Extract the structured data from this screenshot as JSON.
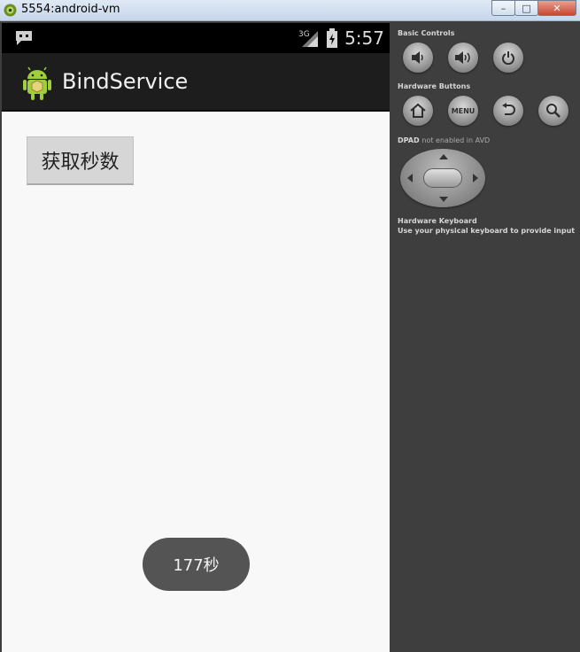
{
  "window": {
    "title": "5554:android-vm",
    "buttons": {
      "minimize": "–",
      "maximize": "□",
      "close": "✕"
    }
  },
  "status_bar": {
    "network": "3G",
    "time": "5:57"
  },
  "action_bar": {
    "title": "BindService"
  },
  "content": {
    "get_seconds_button": "获取秒数",
    "toast": "177秒"
  },
  "panel": {
    "basic_controls": "Basic Controls",
    "hardware_buttons": "Hardware Buttons",
    "menu_label": "MENU",
    "dpad_label": "DPAD",
    "dpad_note": "not enabled in AVD",
    "keyboard_heading": "Hardware Keyboard",
    "keyboard_note": "Use your physical keyboard to provide input"
  },
  "colors": {
    "panel_bg": "#3e3e3e",
    "screen_bg": "#f8f8f8",
    "actionbar_bg": "#1d1d1d",
    "toast_bg": "#545454"
  },
  "icons": [
    "emulator-icon",
    "message-icon",
    "signal-icon",
    "battery-icon",
    "android-icon",
    "volume-down-icon",
    "volume-up-icon",
    "power-icon",
    "home-icon",
    "back-icon",
    "search-icon"
  ]
}
